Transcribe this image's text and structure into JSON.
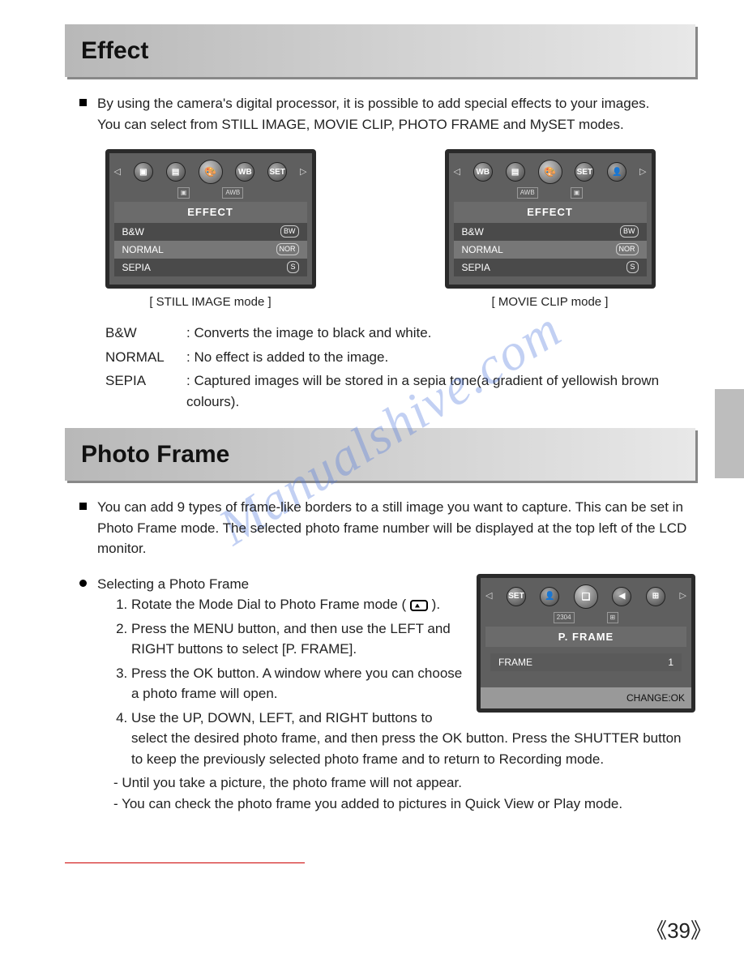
{
  "sections": {
    "effect": {
      "title": "Effect",
      "intro1": "By using the camera's digital processor, it is possible to add special effects to your images.",
      "intro2": "You can select from STILL IMAGE, MOVIE CLIP, PHOTO FRAME and MySET modes.",
      "screens": {
        "left_caption": "[ STILL IMAGE mode ]",
        "right_caption": "[ MOVIE CLIP mode ]",
        "menu_title": "EFFECT",
        "items": [
          {
            "label": "B&W",
            "tag": "BW",
            "selected": false
          },
          {
            "label": "NORMAL",
            "tag": "NOR",
            "selected": true
          },
          {
            "label": "SEPIA",
            "tag": "S",
            "selected": false
          }
        ],
        "left_icons": {
          "sub": "AWB",
          "wb": "WB",
          "set": "SET"
        },
        "right_icons": {
          "sub": "AWB",
          "wb": "WB",
          "set": "SET"
        }
      },
      "defs": [
        {
          "term": "B&W",
          "desc": "Converts the image to black and white."
        },
        {
          "term": "NORMAL",
          "desc": "No effect is added to the image."
        },
        {
          "term": "SEPIA",
          "desc": "Captured images will be stored in a sepia tone(a gradient of yellowish brown colours)."
        }
      ]
    },
    "photoframe": {
      "title": "Photo Frame",
      "intro": "You can add 9 types of frame-like borders to a still image you want to capture. This can be set in Photo Frame mode. The selected photo frame number will be displayed at the top left of the LCD monitor.",
      "subhead": "Selecting a Photo Frame",
      "steps": [
        "Rotate the Mode Dial to Photo Frame mode (        ).",
        "Press the MENU button, and then use the LEFT and RIGHT buttons to select [P. FRAME].",
        "Press the OK button. A window where you can choose a photo frame will open.",
        "Use the UP, DOWN, LEFT, and RIGHT buttons to select the desired photo frame, and then press the OK button. Press the SHUTTER button to keep the previously selected photo frame and to return to Recording mode."
      ],
      "notes": [
        "- Until you take a picture, the photo frame will not appear.",
        "- You can check the photo frame you added to pictures in Quick View or Play mode."
      ],
      "screen": {
        "menu_title": "P. FRAME",
        "row_label": "FRAME",
        "row_value": "1",
        "footer": "CHANGE:OK",
        "badge": "2304",
        "set": "SET"
      }
    }
  },
  "watermark": "Manualshive.com",
  "page_number": "39"
}
